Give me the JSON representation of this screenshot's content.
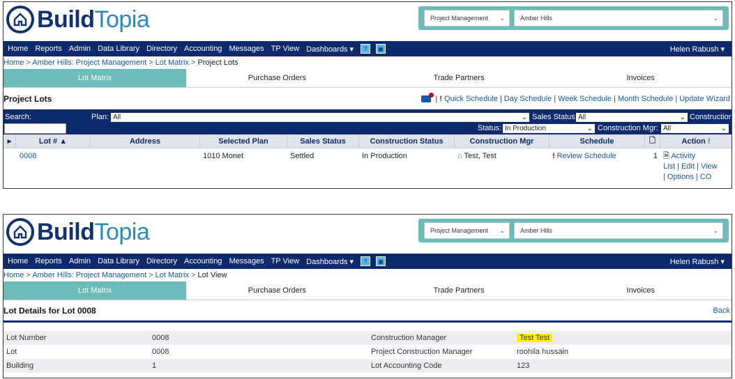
{
  "app": {
    "logo_build": "Build",
    "logo_topia": "Topia"
  },
  "selectors": {
    "project": "Project Management",
    "community": "Amber Hills"
  },
  "nav": {
    "items": [
      "Home",
      "Reports",
      "Admin",
      "Data Library",
      "Directory",
      "Accounting",
      "Messages",
      "TP View",
      "Dashboards"
    ],
    "user": "Helen Rabush"
  },
  "screen1": {
    "breadcrumb": [
      "Home",
      "Amber Hills: Project Management",
      "Lot Matrix",
      "Project Lots"
    ],
    "tabs": [
      "Lot Matrix",
      "Purchase Orders",
      "Trade Partners",
      "Invoices"
    ],
    "title": "Project Lots",
    "schedule_links": [
      "Quick Schedule",
      "Day Schedule",
      "Week Schedule",
      "Month Schedule",
      "Update Wizard"
    ],
    "filters": {
      "search_label": "Search:",
      "plan_label": "Plan:",
      "plan_value": "All",
      "sales_label": "Sales Status:",
      "sales_value": "All",
      "construction_label": "Construction",
      "status_label": "Status:",
      "status_value": "In Production",
      "mgr_label": "Construction Mgr:",
      "mgr_value": "All"
    },
    "columns": [
      "Lot #",
      "Address",
      "Selected Plan",
      "Sales Status",
      "Construction Status",
      "Construction Mgr",
      "Schedule",
      "Action"
    ],
    "row": {
      "lot": "0008",
      "address": "",
      "plan": "1010 Monet",
      "sales": "Settled",
      "construction": "In Production",
      "mgr": "Test, Test",
      "schedule": "Review Schedule",
      "count": "1",
      "activity": "Activity",
      "actions_line1": "List | Edit | View",
      "actions_line2": "| Options |  CO"
    }
  },
  "screen2": {
    "breadcrumb": [
      "Home",
      "Amber Hills: Project Management",
      "Lot Matrix",
      "Lot View"
    ],
    "tabs": [
      "Lot Matrix",
      "Purchase Orders",
      "Trade Partners",
      "Invoices"
    ],
    "title": "Lot Details for Lot 0008",
    "back": "Back",
    "rows": [
      {
        "l1": "Lot Number",
        "v1": "0008",
        "l2": "Construction Manager",
        "v2": "Test Test"
      },
      {
        "l1": "Lot",
        "v1": "0008",
        "l2": "Project Construction Manager",
        "v2": "roohila hussain"
      },
      {
        "l1": "Building",
        "v1": "1",
        "l2": "Lot Accounting Code",
        "v2": "123"
      }
    ]
  },
  "colors": {
    "navy": "#0d2a6f",
    "teal": "#6cbcb9",
    "link": "#1a55a6",
    "highlight": "#fff200"
  }
}
